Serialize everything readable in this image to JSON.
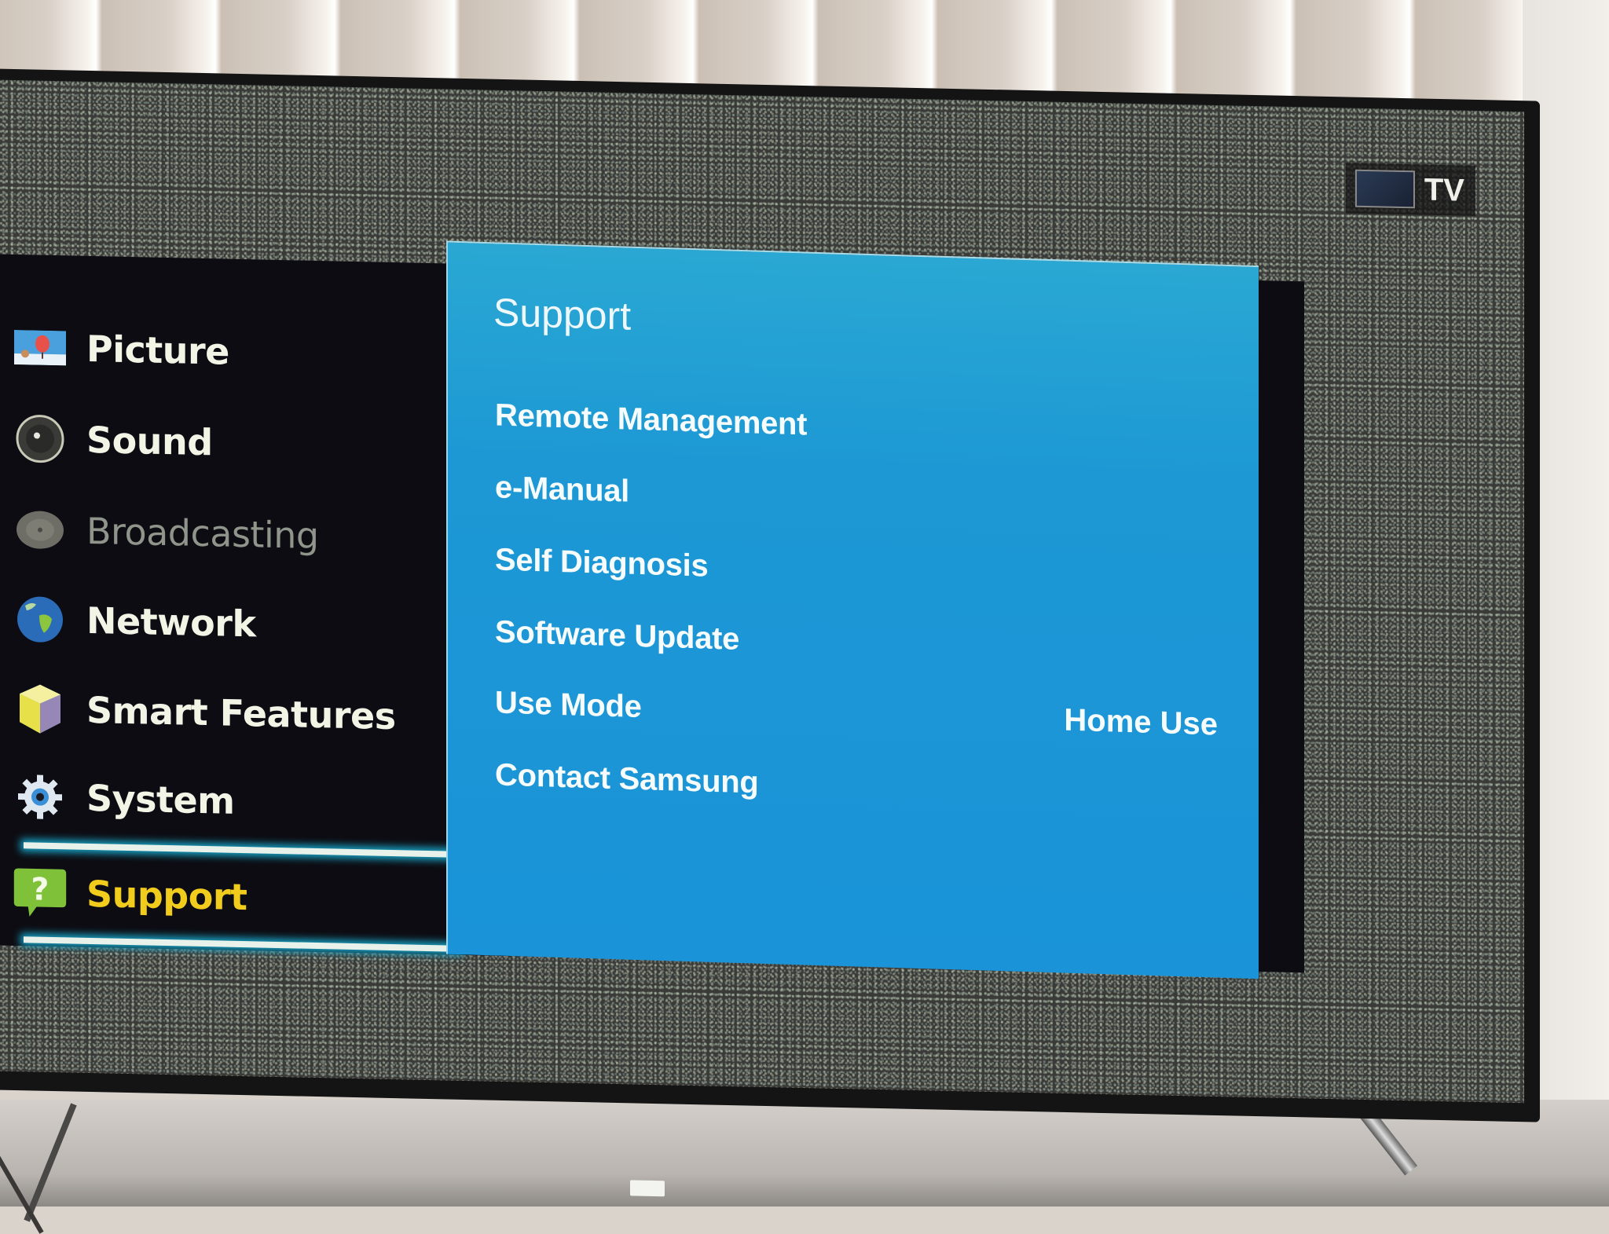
{
  "source_badge": {
    "icon": "tv-source-thumbnail-icon",
    "label": "TV"
  },
  "side_menu": {
    "items": [
      {
        "label": "Picture",
        "icon": "picture-balloon-icon",
        "state": "normal"
      },
      {
        "label": "Sound",
        "icon": "speaker-icon",
        "state": "normal"
      },
      {
        "label": "Broadcasting",
        "icon": "satellite-dish-icon",
        "state": "disabled"
      },
      {
        "label": "Network",
        "icon": "globe-icon",
        "state": "normal"
      },
      {
        "label": "Smart Features",
        "icon": "cube-icon",
        "state": "normal"
      },
      {
        "label": "System",
        "icon": "gear-icon",
        "state": "normal"
      },
      {
        "label": "Support",
        "icon": "help-bubble-icon",
        "state": "selected"
      }
    ]
  },
  "support_panel": {
    "title": "Support",
    "items": [
      {
        "label": "Remote Management",
        "value": ""
      },
      {
        "label": "e-Manual",
        "value": ""
      },
      {
        "label": "Self Diagnosis",
        "value": ""
      },
      {
        "label": "Software Update",
        "value": ""
      },
      {
        "label": "Use Mode",
        "value": "Home Use"
      },
      {
        "label": "Contact Samsung",
        "value": ""
      }
    ]
  },
  "colors": {
    "panel_blue": "#1a93d8",
    "selected_text": "#f2cc1c",
    "highlight_glow": "#19a6c9",
    "menu_bg": "#0d0c12"
  }
}
